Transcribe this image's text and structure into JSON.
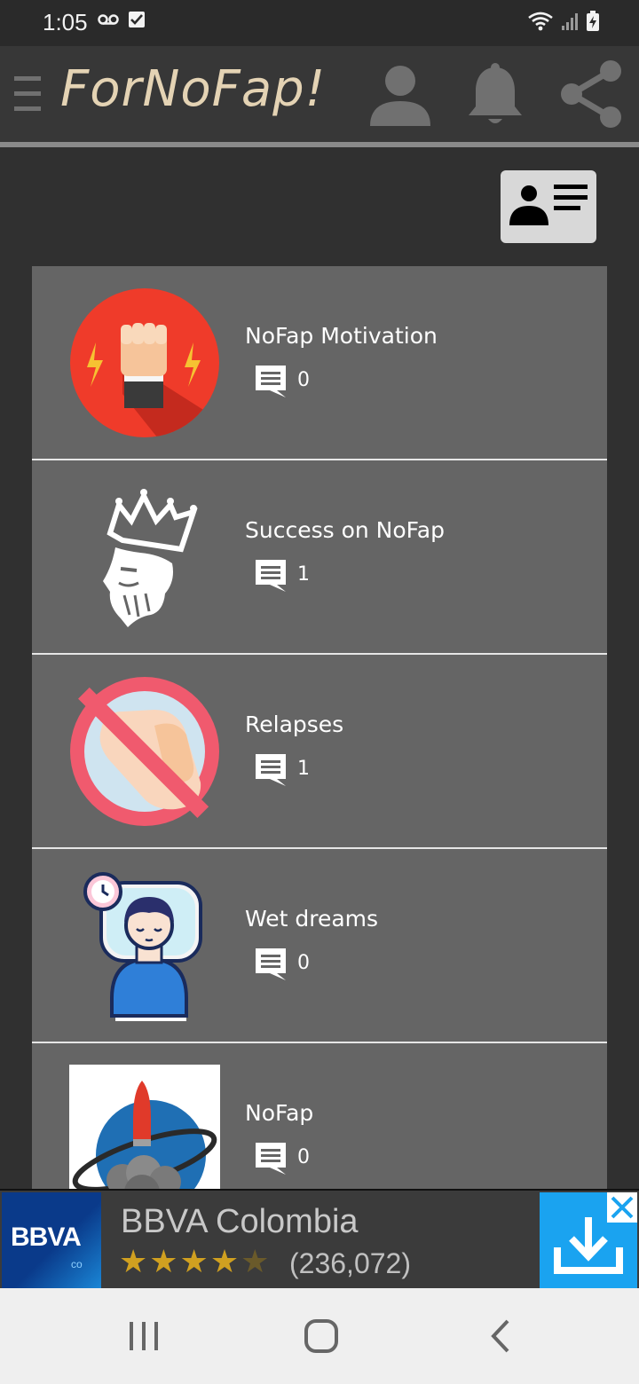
{
  "status_bar": {
    "time": "1:05"
  },
  "app_bar": {
    "title": "ForNoFap!"
  },
  "forums": [
    {
      "title": "NoFap Motivation",
      "comments": "0",
      "icon": "raised-fist-icon"
    },
    {
      "title": "Success on NoFap",
      "comments": "1",
      "icon": "bearded-king-icon"
    },
    {
      "title": "Relapses",
      "comments": "1",
      "icon": "prohibited-hand-icon"
    },
    {
      "title": "Wet dreams",
      "comments": "0",
      "icon": "sleeping-boy-icon"
    },
    {
      "title": "NoFap",
      "comments": "0",
      "icon": "rocket-planet-icon"
    }
  ],
  "ad": {
    "logo_text": "BBVA",
    "logo_sub": "co",
    "title": "BBVA Colombia",
    "rating": 4.5,
    "reviews": "(236,072)",
    "colors": {
      "logo": "#0a3a8a",
      "download": "#1aa3f0",
      "stars": "#d0a020"
    }
  },
  "colors": {
    "background": "#303030",
    "app_bar": "#373737",
    "title": "#e4d3b4",
    "list_item": "#656565"
  }
}
